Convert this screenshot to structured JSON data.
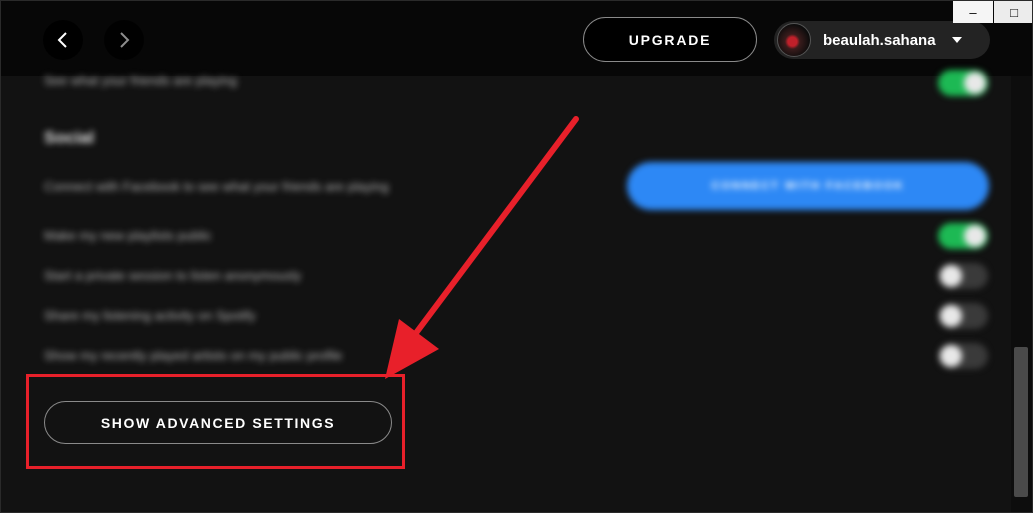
{
  "topbar": {
    "upgrade_label": "UPGRADE",
    "username": "beaulah.sahana"
  },
  "window_controls": {
    "minimize_glyph": "–",
    "close_glyph": "□"
  },
  "settings": {
    "top_row_text": "See what your friends are playing",
    "section_heading": "Social",
    "facebook_text": "Connect with Facebook to see what your friends are playing",
    "facebook_button_label": "CONNECT WITH FACEBOOK",
    "rows": [
      {
        "label": "Make my new playlists public",
        "enabled": true
      },
      {
        "label": "Start a private session to listen anonymously",
        "enabled": false
      },
      {
        "label": "Share my listening activity on Spotify",
        "enabled": false
      },
      {
        "label": "Show my recently played artists on my public profile",
        "enabled": false
      }
    ],
    "advanced_label": "SHOW ADVANCED SETTINGS"
  },
  "colors": {
    "accent_green": "#1db954",
    "facebook_blue": "#2d88f5",
    "annotation_red": "#e8202a"
  },
  "icons": [
    "chevron-left-icon",
    "chevron-right-icon",
    "caret-down-icon",
    "red-arrow-annotation"
  ]
}
